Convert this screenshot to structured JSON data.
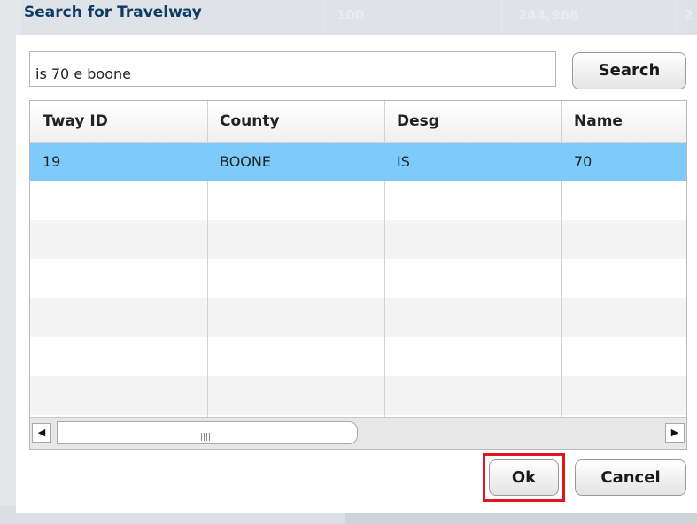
{
  "dialog": {
    "title": "Search for Travelway"
  },
  "background": {
    "ghost_values": [
      "100",
      "244,968",
      "2"
    ]
  },
  "search": {
    "value": "is 70 e boone",
    "button_label": "Search"
  },
  "grid": {
    "columns": [
      "Tway ID",
      "County",
      "Desg",
      "Name"
    ],
    "rows": [
      {
        "tway_id": "19",
        "county": "BOONE",
        "desg": "IS",
        "name": "70",
        "selected": true
      }
    ]
  },
  "footer": {
    "ok_label": "Ok",
    "cancel_label": "Cancel"
  },
  "icons": {
    "scroll_left": "arrow-left-icon",
    "scroll_right": "arrow-right-icon",
    "grip": "grip-icon"
  },
  "colors": {
    "title": "#0f3c66",
    "selected_row": "#7ecbfb",
    "highlight": "#e4141d"
  }
}
